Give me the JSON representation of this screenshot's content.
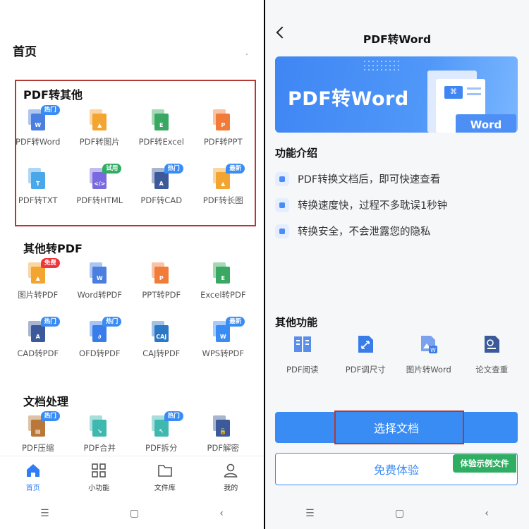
{
  "left": {
    "title": "首页",
    "sections": [
      {
        "title": "PDF转其他",
        "items": [
          {
            "label": "PDF转Word",
            "badge": "热门",
            "badge_color": "blue",
            "color": "#4a7fe0",
            "glyph": "W",
            "icon": "pdf-to-word-icon"
          },
          {
            "label": "PDF转图片",
            "badge": "",
            "badge_color": "",
            "color": "#f3a531",
            "glyph": "▲",
            "icon": "pdf-to-image-icon"
          },
          {
            "label": "PDF转Excel",
            "badge": "",
            "badge_color": "",
            "color": "#39a862",
            "glyph": "E",
            "icon": "pdf-to-excel-icon"
          },
          {
            "label": "PDF转PPT",
            "badge": "",
            "badge_color": "",
            "color": "#f27b3a",
            "glyph": "P",
            "icon": "pdf-to-ppt-icon"
          },
          {
            "label": "PDF转TXT",
            "badge": "",
            "badge_color": "",
            "color": "#4aa7e8",
            "glyph": "T",
            "icon": "pdf-to-txt-icon"
          },
          {
            "label": "PDF转HTML",
            "badge": "试用",
            "badge_color": "green",
            "color": "#7a6ae0",
            "glyph": "</>",
            "icon": "pdf-to-html-icon"
          },
          {
            "label": "PDF转CAD",
            "badge": "热门",
            "badge_color": "blue",
            "color": "#3c5a9a",
            "glyph": "A",
            "icon": "pdf-to-cad-icon"
          },
          {
            "label": "PDF转长图",
            "badge": "最新",
            "badge_color": "blue",
            "color": "#f3a531",
            "glyph": "▲",
            "icon": "pdf-to-long-image-icon"
          }
        ]
      },
      {
        "title": "其他转PDF",
        "items": [
          {
            "label": "图片转PDF",
            "badge": "免费",
            "badge_color": "red",
            "color": "#f3a531",
            "glyph": "▲",
            "icon": "image-to-pdf-icon"
          },
          {
            "label": "Word转PDF",
            "badge": "",
            "badge_color": "",
            "color": "#4a7fe0",
            "glyph": "W",
            "icon": "word-to-pdf-icon"
          },
          {
            "label": "PPT转PDF",
            "badge": "",
            "badge_color": "",
            "color": "#f27b3a",
            "glyph": "P",
            "icon": "ppt-to-pdf-icon"
          },
          {
            "label": "Excel转PDF",
            "badge": "",
            "badge_color": "",
            "color": "#39a862",
            "glyph": "E",
            "icon": "excel-to-pdf-icon"
          },
          {
            "label": "CAD转PDF",
            "badge": "热门",
            "badge_color": "blue",
            "color": "#3c5a9a",
            "glyph": "A",
            "icon": "cad-to-pdf-icon"
          },
          {
            "label": "OFD转PDF",
            "badge": "热门",
            "badge_color": "blue",
            "color": "#3a7ce8",
            "glyph": "∂",
            "icon": "ofd-to-pdf-icon"
          },
          {
            "label": "CAJ转PDF",
            "badge": "",
            "badge_color": "",
            "color": "#2d78c4",
            "glyph": "CAJ",
            "icon": "caj-to-pdf-icon"
          },
          {
            "label": "WPS转PDF",
            "badge": "最新",
            "badge_color": "blue",
            "color": "#3a8cf5",
            "glyph": "W",
            "icon": "wps-to-pdf-icon"
          }
        ]
      },
      {
        "title": "文档处理",
        "items": [
          {
            "label": "PDF压缩",
            "badge": "热门",
            "badge_color": "blue",
            "color": "#b9773a",
            "glyph": "▤",
            "icon": "pdf-compress-icon"
          },
          {
            "label": "PDF合并",
            "badge": "",
            "badge_color": "",
            "color": "#3fb8b0",
            "glyph": "↘",
            "icon": "pdf-merge-icon"
          },
          {
            "label": "PDF拆分",
            "badge": "热门",
            "badge_color": "blue",
            "color": "#3fb8b0",
            "glyph": "↖",
            "icon": "pdf-split-icon"
          },
          {
            "label": "PDF解密",
            "badge": "",
            "badge_color": "",
            "color": "#3c5a9a",
            "glyph": "🔓",
            "icon": "pdf-decrypt-icon"
          }
        ]
      }
    ],
    "nav": [
      {
        "label": "首页",
        "icon": "home-icon",
        "active": true
      },
      {
        "label": "小功能",
        "icon": "grid-icon",
        "active": false
      },
      {
        "label": "文件库",
        "icon": "folder-icon",
        "active": false
      },
      {
        "label": "我的",
        "icon": "user-icon",
        "active": false
      }
    ]
  },
  "right": {
    "title": "PDF转Word",
    "banner": {
      "title": "PDF转Word",
      "tag": "Word"
    },
    "intro_title": "功能介绍",
    "features": [
      "PDF转换文档后，即可快速查看",
      "转换速度快，过程不多耽误1秒钟",
      "转换安全，不会泄露您的隐私"
    ],
    "other_title": "其他功能",
    "other_items": [
      {
        "label": "PDF阅读",
        "icon": "book-icon"
      },
      {
        "label": "PDF调尺寸",
        "icon": "resize-icon"
      },
      {
        "label": "图片转Word",
        "icon": "image-to-word-icon"
      },
      {
        "label": "论文查重",
        "icon": "paper-check-icon"
      }
    ],
    "primary_button": "选择文档",
    "secondary_button": "免费体验",
    "sample_tag": "体验示例文件"
  },
  "colors": {
    "accent": "#3a8cf5",
    "highlight": "#b23a35",
    "green": "#2fae63",
    "red": "#f0353d"
  }
}
